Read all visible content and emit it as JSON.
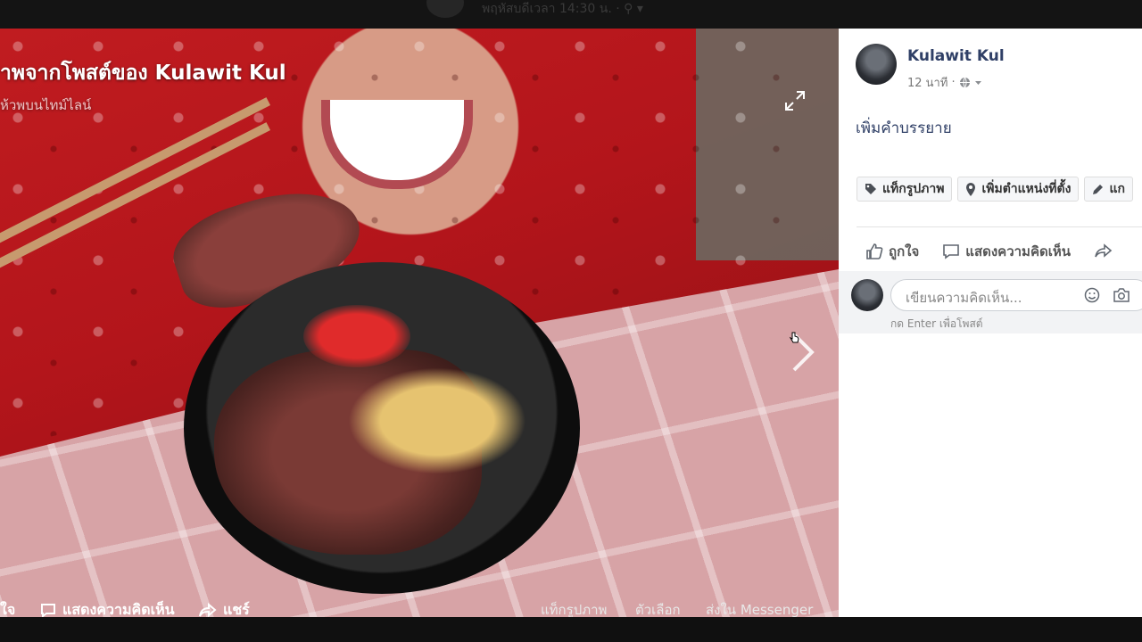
{
  "topbar": {
    "ghost_text": "พฤหัสบดีเวลา 14:30 น. · ⚲ ▾"
  },
  "photo": {
    "title": "าพจากโพสต์ของ Kulawit Kul",
    "subtitle": "ห้วพบนไทม์ไลน์",
    "actions": {
      "like_label": "ใจ",
      "comment_label": "แสดงความคิดเห็น",
      "share_label": "แชร์",
      "tag_label": "แท็กรูปภาพ",
      "options_label": "ตัวเลือก",
      "messenger_label": "ส่งใน Messenger"
    }
  },
  "post": {
    "author": "Kulawit Kul",
    "time": "12 นาที",
    "caption": "เพิ่มคำบรรยาย",
    "tag_buttons": [
      "แท็กรูปภาพ",
      "เพิ่มตำแหน่งที่ตั้ง",
      "แก"
    ],
    "like_label": "ถูกใจ",
    "comment_label": "แสดงความคิดเห็น"
  },
  "comment": {
    "placeholder": "เขียนความคิดเห็น...",
    "hint": "กด Enter เพื่อโพสต์"
  },
  "colors": {
    "name_blue": "#2f3f66",
    "panel_bg": "#ffffff",
    "backdrop": "#0b0b0b"
  }
}
